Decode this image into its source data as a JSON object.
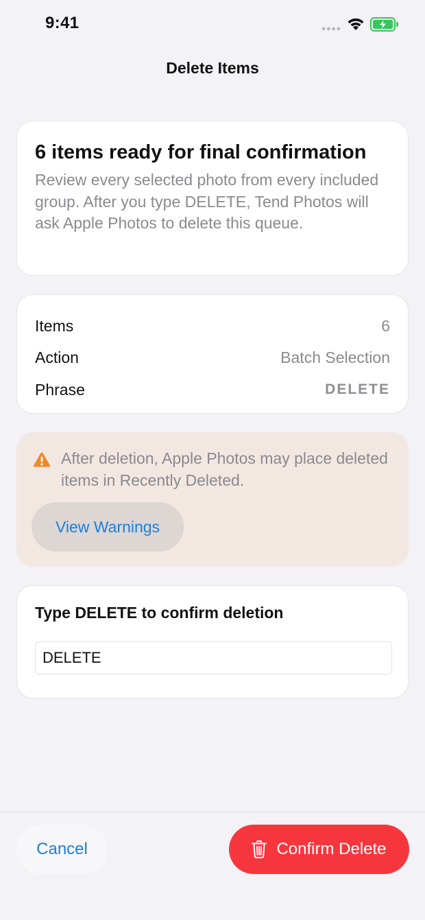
{
  "status_bar": {
    "time": "9:41",
    "icons": [
      "signal-dots-icon",
      "wifi-icon",
      "battery-charging-icon"
    ],
    "battery_color": "#34c759"
  },
  "nav": {
    "title": "Delete Items"
  },
  "summary": {
    "title": "6 items ready for final confirmation",
    "description": "Review every selected photo from every included group. After you type DELETE, Tend Photos will ask Apple Photos to delete this queue."
  },
  "details": {
    "rows": [
      {
        "label": "Items",
        "value": "6"
      },
      {
        "label": "Action",
        "value": "Batch Selection"
      },
      {
        "label": "Phrase",
        "value": "DELETE"
      }
    ]
  },
  "warning": {
    "icon": "warning-triangle-icon",
    "icon_color": "#f0892b",
    "text": "After deletion, Apple Photos may place deleted items in Recently Deleted.",
    "button_label": "View Warnings"
  },
  "confirm": {
    "label": "Type DELETE to confirm deletion",
    "input_value": "DELETE"
  },
  "actions": {
    "cancel_label": "Cancel",
    "confirm_label": "Confirm Delete",
    "accent_color": "#1a7fe0",
    "destructive_color": "#f5373d"
  }
}
